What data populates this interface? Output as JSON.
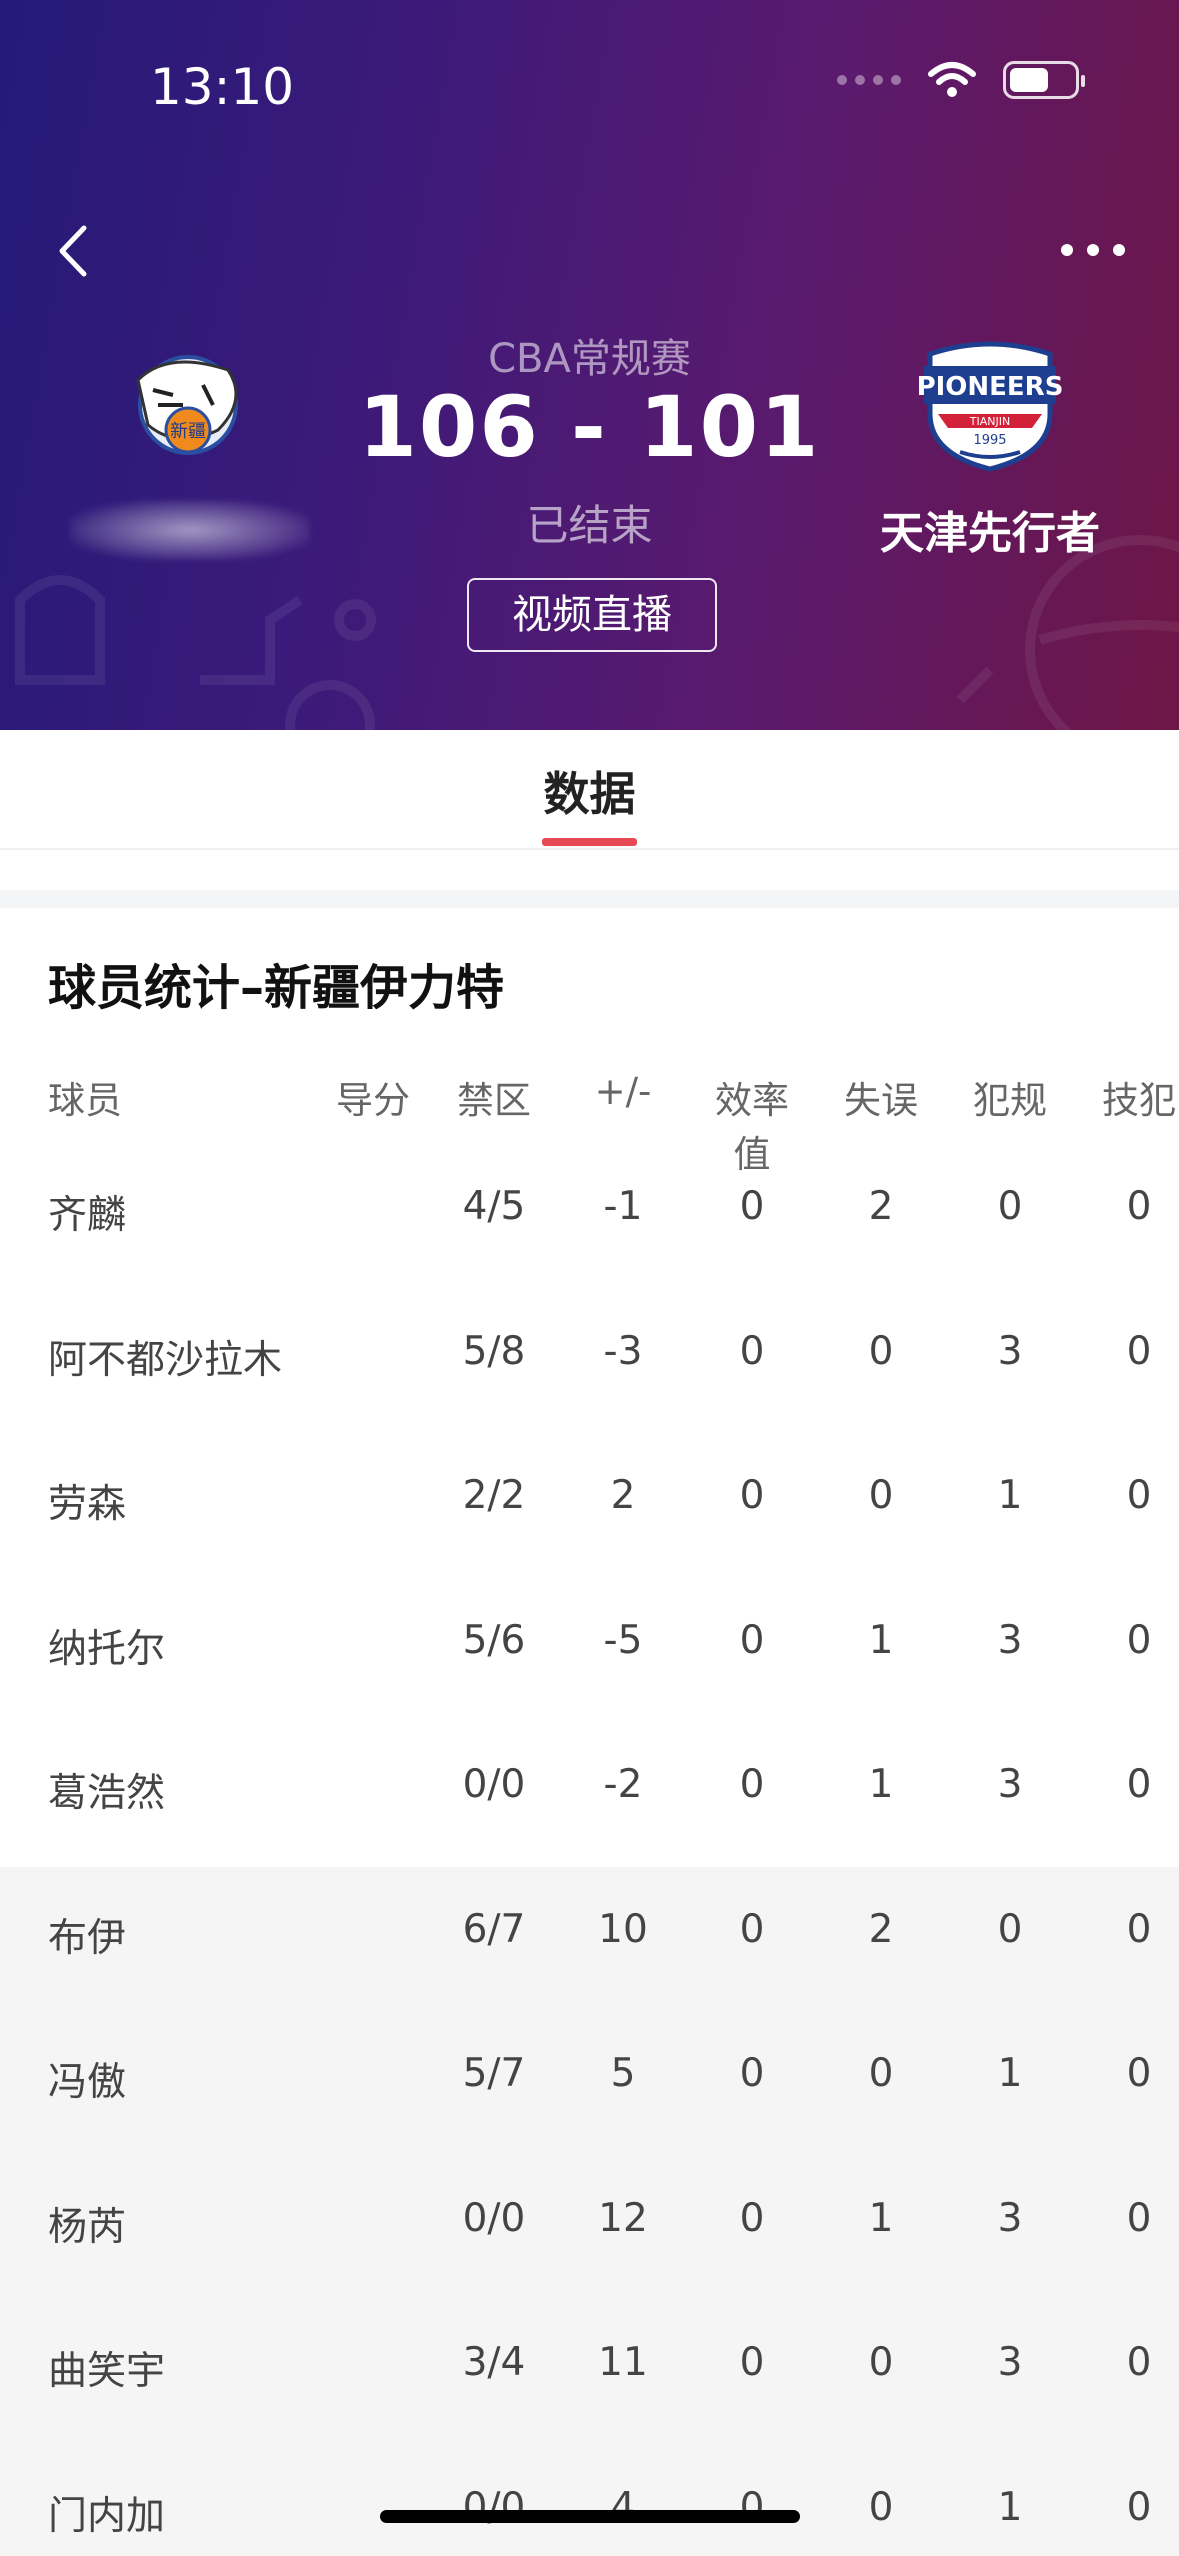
{
  "status_bar": {
    "time": "13:10"
  },
  "header": {
    "league": "CBA常规赛",
    "score": "106 - 101",
    "status": "已结束",
    "video_button": "视频直播",
    "home_team": {
      "logo_icon": "xinjiang-tigers-logo",
      "logo_text": "新疆"
    },
    "away_team": {
      "name": "天津先行者",
      "logo_icon": "tianjin-pioneers-logo",
      "logo_text": "PIONEERS",
      "logo_sub": "TIANJIN",
      "logo_year": "1995"
    }
  },
  "tabs": [
    {
      "label": "数据",
      "active": true
    }
  ],
  "stats": {
    "title": "球员统计–新疆伊力特",
    "columns": [
      "球员",
      "得分",
      "禁区",
      "+/-",
      "效率值",
      "失误",
      "犯规",
      "技犯"
    ],
    "header_partial": "导分",
    "rows": [
      {
        "player": "齐麟",
        "paint": "4/5",
        "plusminus": "-1",
        "eff": "0",
        "to": "2",
        "fouls": "0",
        "tech": "0"
      },
      {
        "player": "阿不都沙拉木",
        "paint": "5/8",
        "plusminus": "-3",
        "eff": "0",
        "to": "0",
        "fouls": "3",
        "tech": "0"
      },
      {
        "player": "劳森",
        "paint": "2/2",
        "plusminus": "2",
        "eff": "0",
        "to": "0",
        "fouls": "1",
        "tech": "0"
      },
      {
        "player": "纳托尔",
        "paint": "5/6",
        "plusminus": "-5",
        "eff": "0",
        "to": "1",
        "fouls": "3",
        "tech": "0"
      },
      {
        "player": "葛浩然",
        "paint": "0/0",
        "plusminus": "-2",
        "eff": "0",
        "to": "1",
        "fouls": "3",
        "tech": "0"
      },
      {
        "player": "布伊",
        "paint": "6/7",
        "plusminus": "10",
        "eff": "0",
        "to": "2",
        "fouls": "0",
        "tech": "0"
      },
      {
        "player": "冯傲",
        "paint": "5/7",
        "plusminus": "5",
        "eff": "0",
        "to": "0",
        "fouls": "1",
        "tech": "0"
      },
      {
        "player": "杨芮",
        "paint": "0/0",
        "plusminus": "12",
        "eff": "0",
        "to": "1",
        "fouls": "3",
        "tech": "0"
      },
      {
        "player": "曲笑宇",
        "paint": "3/4",
        "plusminus": "11",
        "eff": "0",
        "to": "0",
        "fouls": "3",
        "tech": "0"
      },
      {
        "player": "门内加",
        "paint": "0/0",
        "plusminus": "4",
        "eff": "0",
        "to": "0",
        "fouls": "1",
        "tech": "0"
      }
    ]
  },
  "colors": {
    "accent": "#e84a55",
    "header_start": "#251a78",
    "header_end": "#6e1646"
  }
}
